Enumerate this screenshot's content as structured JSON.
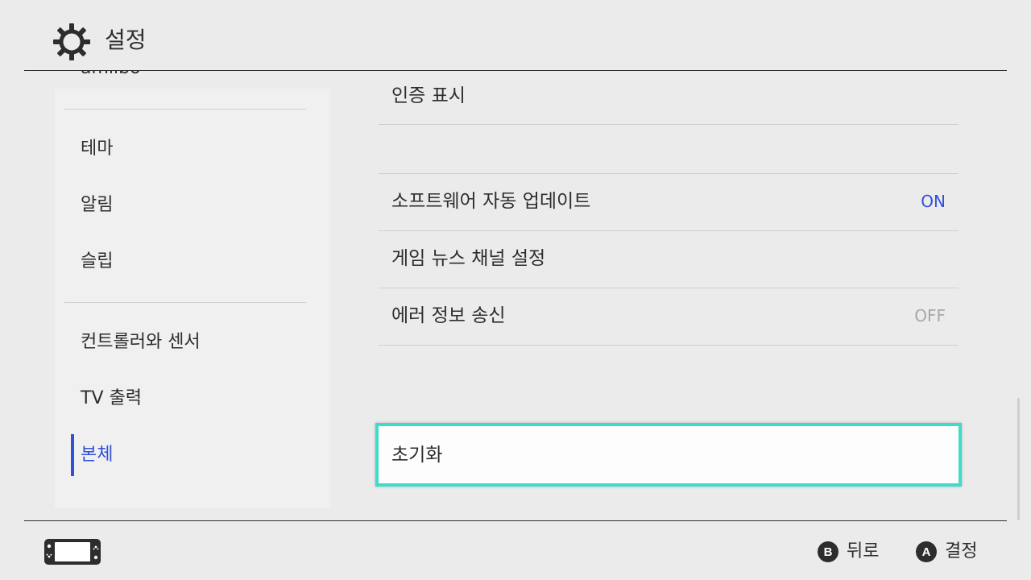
{
  "header": {
    "title": "설정",
    "icon": "gear-icon"
  },
  "sidebar": {
    "items": [
      {
        "label": "amiibo"
      },
      {
        "label": "테마"
      },
      {
        "label": "알림"
      },
      {
        "label": "슬립"
      },
      {
        "label": "컨트롤러와 센서"
      },
      {
        "label": "TV 출력"
      },
      {
        "label": "본체",
        "active": true
      }
    ],
    "active_color": "#3250d8"
  },
  "main": {
    "rows": [
      {
        "label": "인증 표시",
        "value": ""
      },
      {
        "label": "소프트웨어 자동 업데이트",
        "value": "ON"
      },
      {
        "label": "게임 뉴스 채널 설정",
        "value": ""
      },
      {
        "label": "에러 정보 송신",
        "value": "OFF"
      }
    ],
    "selected": {
      "label": "초기화"
    },
    "highlight_color": "#3fdcca"
  },
  "footer": {
    "console_icon": "console-icon",
    "back": {
      "glyph": "B",
      "label": "뒤로"
    },
    "confirm": {
      "glyph": "A",
      "label": "결정"
    }
  }
}
